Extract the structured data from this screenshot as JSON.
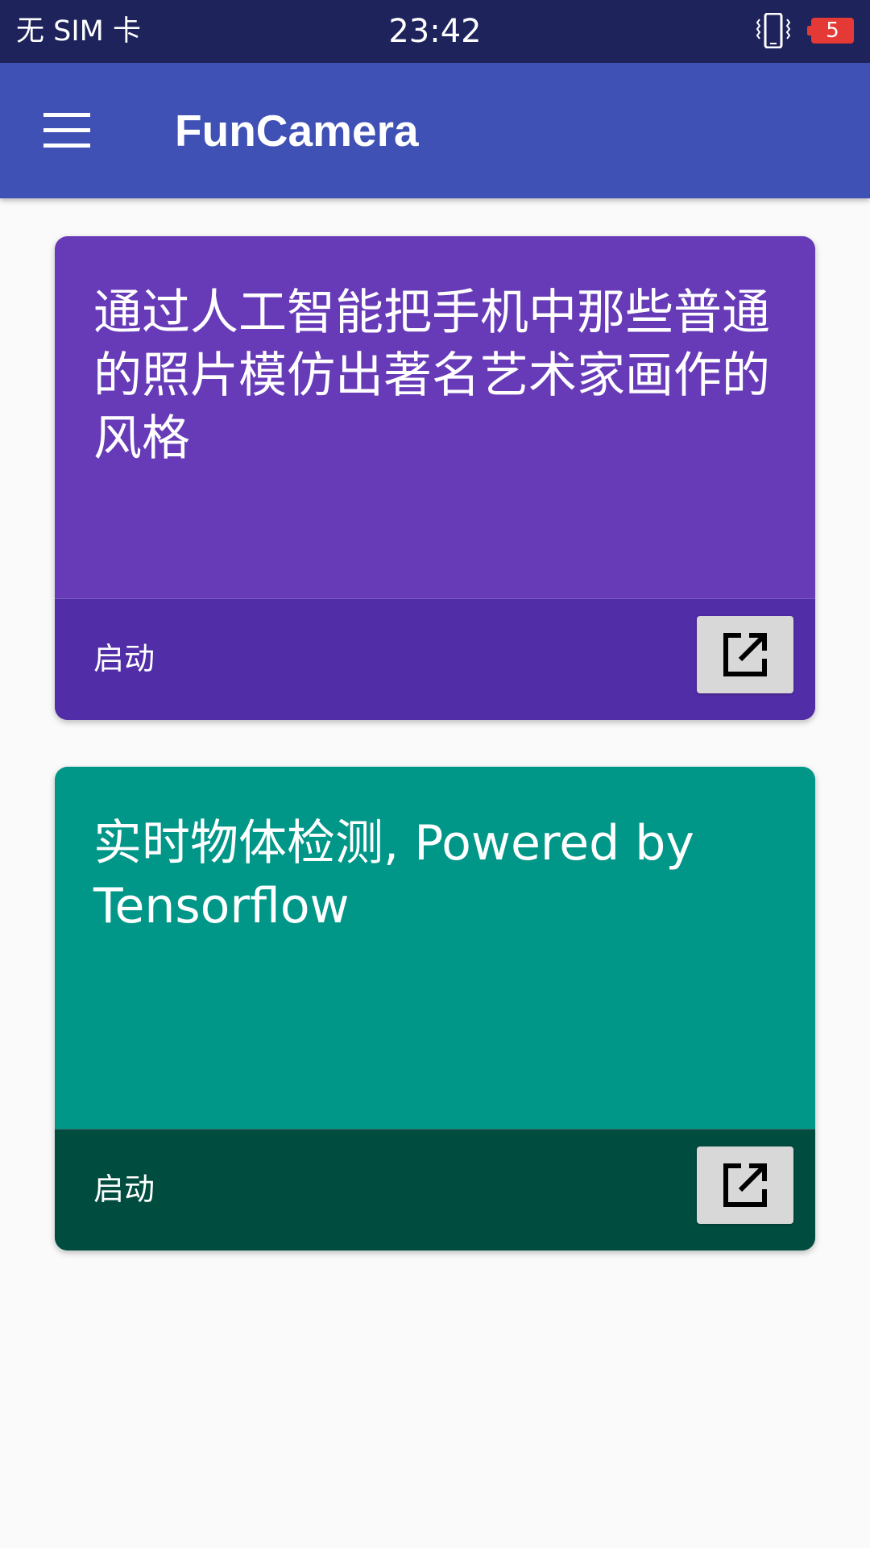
{
  "status_bar": {
    "carrier": "无 SIM 卡",
    "time": "23:42",
    "battery_level": "5",
    "vibrate_icon": "vibrate-icon",
    "battery_color": "#e53935"
  },
  "app_bar": {
    "title": "FunCamera",
    "menu_icon": "menu-icon",
    "color": "#3f51b5"
  },
  "cards": [
    {
      "description": "通过人工智能把手机中那些普通的照片模仿出著名艺术家画作的风格",
      "launch_label": "启动",
      "open_icon": "open-in-new-icon",
      "color": "#673ab7",
      "footer_color": "#512da8"
    },
    {
      "description": "实时物体检测, Powered by Tensorflow",
      "launch_label": "启动",
      "open_icon": "open-in-new-icon",
      "color": "#009688",
      "footer_color": "#004d40"
    }
  ]
}
